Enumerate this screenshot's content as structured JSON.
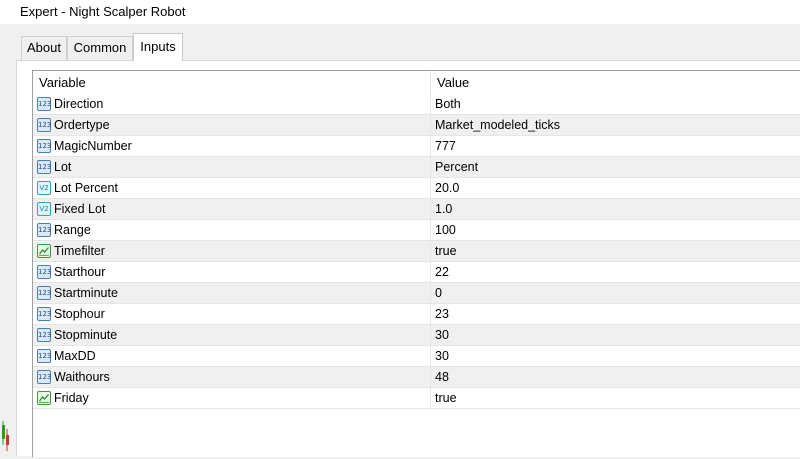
{
  "window": {
    "title": "Expert - Night Scalper Robot"
  },
  "tabs": [
    {
      "label": "About",
      "active": false
    },
    {
      "label": "Common",
      "active": false
    },
    {
      "label": "Inputs",
      "active": true
    }
  ],
  "table": {
    "headers": {
      "variable": "Variable",
      "value": "Value"
    },
    "rows": [
      {
        "icon": "integer-icon",
        "variable": "Direction",
        "value": "Both"
      },
      {
        "icon": "integer-icon",
        "variable": "Ordertype",
        "value": "Market_modeled_ticks"
      },
      {
        "icon": "integer-icon",
        "variable": "MagicNumber",
        "value": "777"
      },
      {
        "icon": "integer-icon",
        "variable": "Lot",
        "value": "Percent"
      },
      {
        "icon": "double-icon",
        "variable": "Lot Percent",
        "value": "20.0"
      },
      {
        "icon": "double-icon",
        "variable": "Fixed Lot",
        "value": "1.0"
      },
      {
        "icon": "integer-icon",
        "variable": "Range",
        "value": "100"
      },
      {
        "icon": "boolean-icon",
        "variable": "Timefilter",
        "value": "true"
      },
      {
        "icon": "integer-icon",
        "variable": "Starthour",
        "value": "22"
      },
      {
        "icon": "integer-icon",
        "variable": "Startminute",
        "value": "0"
      },
      {
        "icon": "integer-icon",
        "variable": "Stophour",
        "value": "23"
      },
      {
        "icon": "integer-icon",
        "variable": "Stopminute",
        "value": "30"
      },
      {
        "icon": "integer-icon",
        "variable": "MaxDD",
        "value": "30"
      },
      {
        "icon": "integer-icon",
        "variable": "Waithours",
        "value": "48"
      },
      {
        "icon": "boolean-icon",
        "variable": "Friday",
        "value": "true"
      }
    ]
  },
  "icon_labels": {
    "integer": "123",
    "double": "V2"
  },
  "colors": {
    "row_alt": "#f0f0f0",
    "int_icon": "#4a7fb5",
    "double_icon": "#3aa0c0",
    "bool_icon": "#3c9a3c"
  }
}
